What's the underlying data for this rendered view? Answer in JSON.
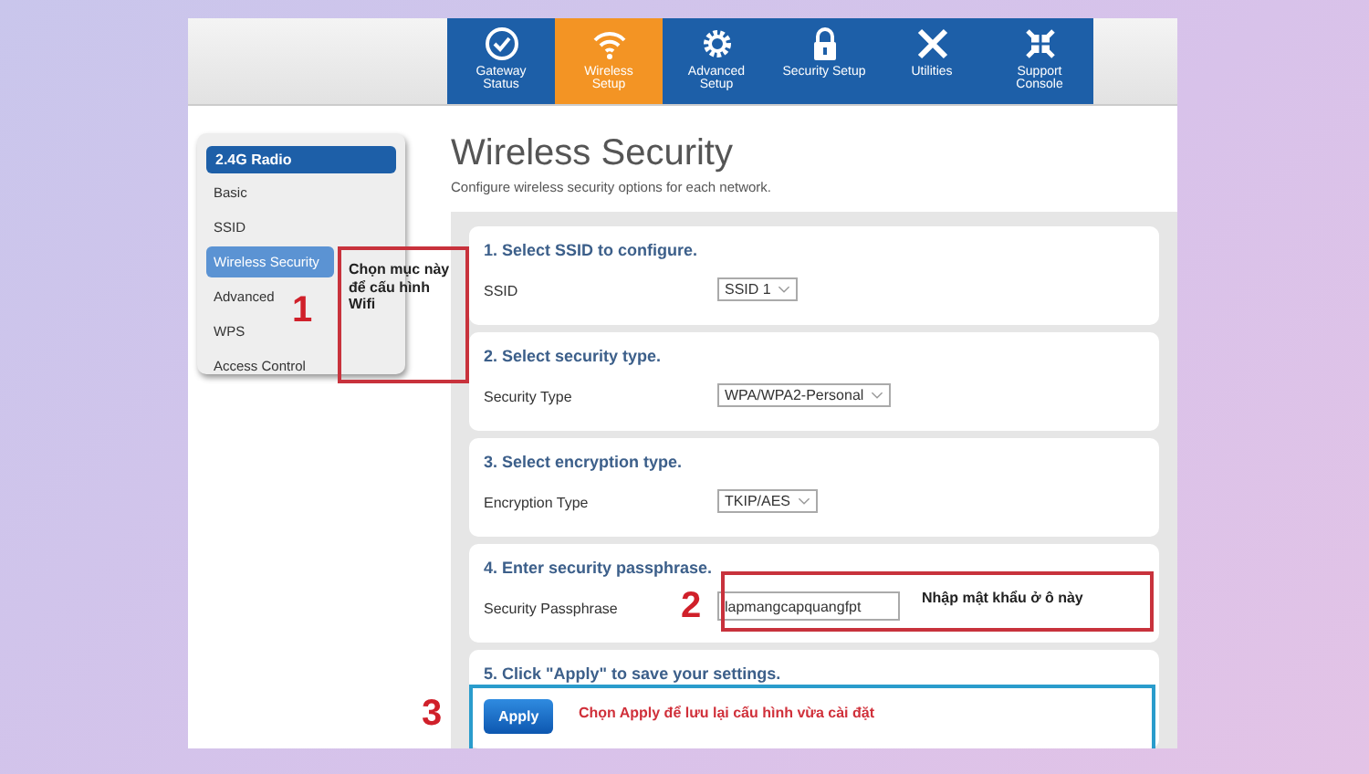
{
  "nav": {
    "tabs": [
      {
        "label": "Gateway Status",
        "selected": false
      },
      {
        "label": "Wireless Setup",
        "selected": true
      },
      {
        "label": "Advanced Setup",
        "selected": false
      },
      {
        "label": "Security Setup",
        "selected": false
      },
      {
        "label": "Utilities",
        "selected": false
      },
      {
        "label": "Support Console",
        "selected": false
      }
    ]
  },
  "sidebar": {
    "header": "2.4G Radio",
    "items": [
      {
        "label": "Basic",
        "selected": false
      },
      {
        "label": "SSID",
        "selected": false
      },
      {
        "label": "Wireless Security",
        "selected": true
      },
      {
        "label": "Advanced",
        "selected": false
      },
      {
        "label": "WPS",
        "selected": false
      },
      {
        "label": "Access Control",
        "selected": false
      }
    ]
  },
  "page": {
    "title": "Wireless Security",
    "subtitle": "Configure wireless security options for each network."
  },
  "sections": [
    {
      "heading": "1. Select SSID to configure.",
      "kind": "select",
      "label": "SSID",
      "value": "SSID 1"
    },
    {
      "heading": "2. Select security type.",
      "kind": "select",
      "label": "Security Type",
      "value": "WPA/WPA2-Personal"
    },
    {
      "heading": "3. Select encryption type.",
      "kind": "select",
      "label": "Encryption Type",
      "value": "TKIP/AES"
    },
    {
      "heading": "4. Enter security passphrase.",
      "kind": "input",
      "label": "Security Passphrase",
      "value": "lapmangcapquangfpt"
    },
    {
      "heading": "5. Click \"Apply\" to save your settings.",
      "kind": "button",
      "value": "Apply"
    }
  ],
  "annotations": [
    {
      "number": "1",
      "text": "Chọn mục này để cấu hình Wifi",
      "color": "#c8323c"
    },
    {
      "number": "2",
      "text": "Nhập mật khẩu ở ô này",
      "color": "#c8323c"
    },
    {
      "number": "3",
      "text": "Chọn Apply để lưu lại cấu hình vừa cài đặt",
      "color": "#2a9ccc"
    }
  ]
}
